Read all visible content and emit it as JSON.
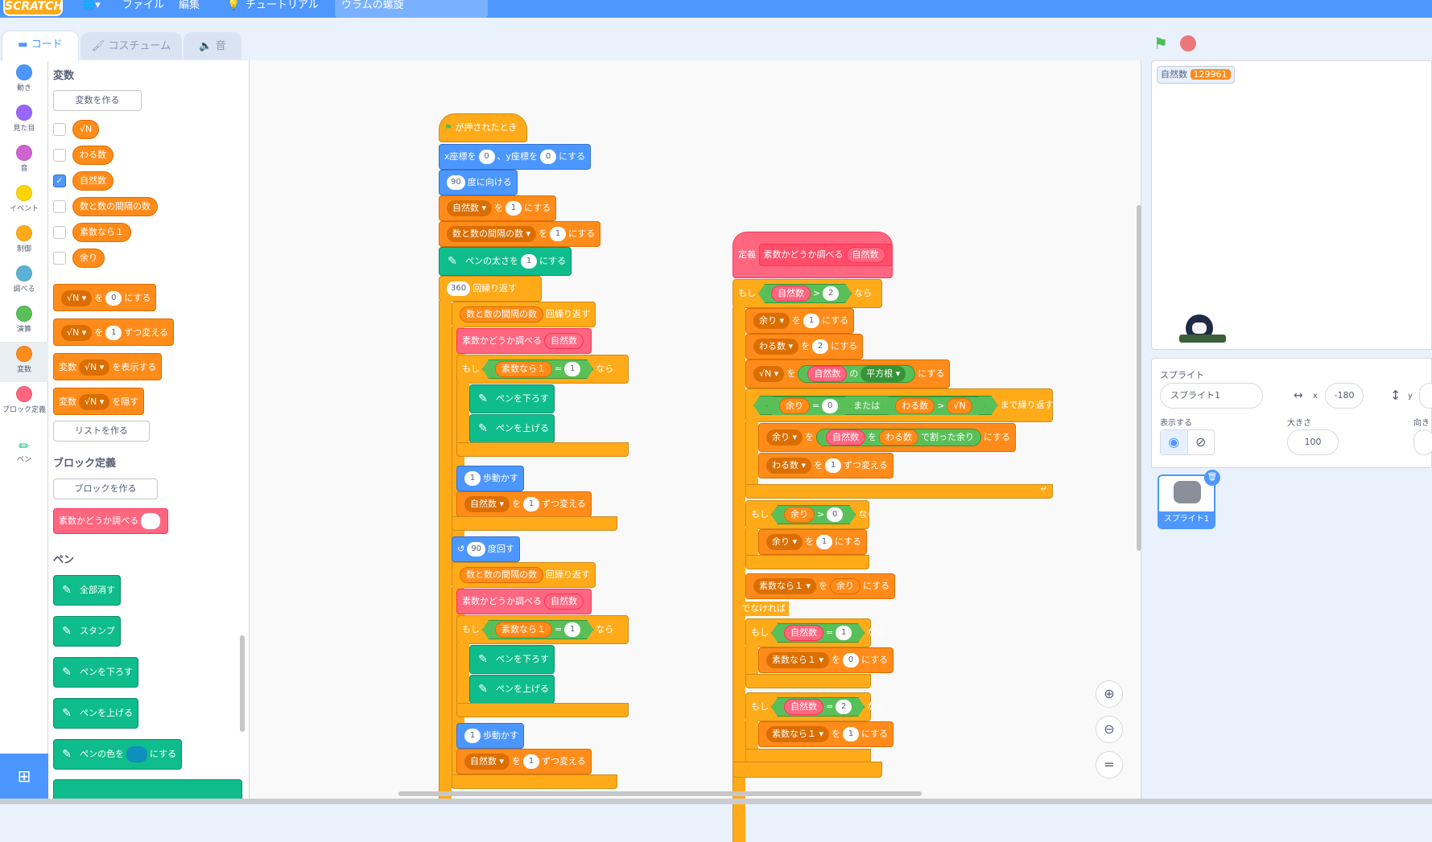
{
  "menubar": {
    "logo": "SCRATCH",
    "globe": "🌐▾",
    "file": "ファイル",
    "edit": "編集",
    "tutorial": "チュートリアル",
    "project_name": "ウラムの螺旋"
  },
  "tabs": {
    "code": "コード",
    "costumes": "コスチューム",
    "sounds": "音"
  },
  "categories": [
    {
      "label": "動き",
      "color": "#4c97ff"
    },
    {
      "label": "見た目",
      "color": "#9966ff"
    },
    {
      "label": "音",
      "color": "#cf63cf"
    },
    {
      "label": "イベント",
      "color": "#ffd500"
    },
    {
      "label": "制御",
      "color": "#ffab19"
    },
    {
      "label": "調べる",
      "color": "#5cb1d6"
    },
    {
      "label": "演算",
      "color": "#59c059"
    },
    {
      "label": "変数",
      "color": "#ff8c1a"
    },
    {
      "label": "ブロック定義",
      "color": "#ff6680"
    },
    {
      "label": "ペン",
      "color": "#0fbd8c"
    }
  ],
  "palette": {
    "variables_heading": "変数",
    "make_variable": "変数を作る",
    "variables": [
      "√N",
      "わる数",
      "自然数",
      "数と数の間隔の数",
      "素数なら１",
      "余り"
    ],
    "checked_variable": "自然数",
    "set_block": {
      "var": "√N ▾",
      "to": "を",
      "value": "0",
      "end": "にする"
    },
    "change_block": {
      "var": "√N ▾",
      "to": "を",
      "value": "1",
      "end": "ずつ変える"
    },
    "show_block": {
      "prefix": "変数",
      "var": "√N ▾",
      "end": "を表示する"
    },
    "hide_block": {
      "prefix": "変数",
      "var": "√N ▾",
      "end": "を隠す"
    },
    "make_list": "リストを作る",
    "myblocks_heading": "ブロック定義",
    "make_block": "ブロックを作る",
    "custom_block": "素数かどうか調べる",
    "pen_heading": "ペン",
    "pen_blocks": [
      "全部消す",
      "スタンプ",
      "ペンを下ろす",
      "ペンを上げる"
    ],
    "pen_color": {
      "prefix": "ペンの色を",
      "end": "にする"
    }
  },
  "script1": {
    "hat": "が押されたとき",
    "goto": {
      "x_label": "x座標を",
      "x": "0",
      "y_label": "、y座標を",
      "y": "0",
      "end": "にする"
    },
    "point": {
      "value": "90",
      "end": "度に向ける"
    },
    "set1": {
      "var": "自然数 ▾",
      "to": "を",
      "value": "1",
      "end": "にする"
    },
    "set2": {
      "var": "数と数の間隔の数 ▾",
      "to": "を",
      "value": "1",
      "end": "にする"
    },
    "pensize": {
      "label": "ペンの太さを",
      "value": "1",
      "end": "にする"
    },
    "repeat": {
      "value": "360",
      "end": "回繰り返す"
    },
    "inner_repeat": {
      "var": "数と数の間隔の数",
      "end": "回繰り返す"
    },
    "call": {
      "label": "素数かどうか調べる",
      "arg": "自然数"
    },
    "if": {
      "label": "もし",
      "var": "素数なら１",
      "op": "=",
      "value": "1",
      "end": "なら"
    },
    "pen_down": "ペンを下ろす",
    "pen_up": "ペンを上げる",
    "move": {
      "value": "1",
      "end": "歩動かす"
    },
    "change": {
      "var": "自然数 ▾",
      "to": "を",
      "value": "1",
      "end": "ずつ変える"
    },
    "turn": {
      "value": "90",
      "end": "度回す"
    }
  },
  "script2": {
    "define_label": "定義",
    "define_name": "素数かどうか調べる",
    "define_arg": "自然数",
    "if1": {
      "label": "もし",
      "var": "自然数",
      "op": ">",
      "value": "2",
      "end": "なら"
    },
    "set_rem": {
      "var": "余り ▾",
      "to": "を",
      "value": "1",
      "end": "にする"
    },
    "set_div": {
      "var": "わる数 ▾",
      "to": "を",
      "value": "2",
      "end": "にする"
    },
    "set_sqrt": {
      "var": "√N ▾",
      "to": "を",
      "arg": "自然数",
      "of": "の",
      "func": "平方根 ▾",
      "end": "にする"
    },
    "until": {
      "var1": "余り",
      "eq": "=",
      "v1": "0",
      "or": "または",
      "var2": "わる数",
      "gt": ">",
      "var3": "√N",
      "end": "まで繰り返す"
    },
    "set_mod": {
      "var": "余り ▾",
      "to": "を",
      "a": "自然数",
      "mid": "を",
      "b": "わる数",
      "op": "で割った余り",
      "end": "にする"
    },
    "change_div": {
      "var": "わる数 ▾",
      "to": "を",
      "value": "1",
      "end": "ずつ変える"
    },
    "if2": {
      "label": "もし",
      "var": "余り",
      "op": ">",
      "value": "0",
      "end": "なら"
    },
    "set_rem2": {
      "var": "余り ▾",
      "to": "を",
      "value": "1",
      "end": "にする"
    },
    "set_prime": {
      "var": "素数なら１ ▾",
      "to": "を",
      "arg": "余り",
      "end": "にする"
    },
    "else": "でなければ",
    "if3": {
      "label": "もし",
      "var": "自然数",
      "op": "=",
      "value": "1",
      "end": "なら"
    },
    "set_prime0": {
      "var": "素数なら１ ▾",
      "to": "を",
      "value": "0",
      "end": "にする"
    },
    "if4": {
      "label": "もし",
      "var": "自然数",
      "op": "=",
      "value": "2",
      "end": "なら"
    },
    "set_prime1": {
      "var": "素数なら１ ▾",
      "to": "を",
      "value": "1",
      "end": "にする"
    }
  },
  "stage": {
    "monitor_label": "自然数",
    "monitor_value": "129961"
  },
  "sprite_info": {
    "heading": "スプライト",
    "name": "スプライト1",
    "x_label": "x",
    "x": "-180",
    "y_label": "y",
    "show_label": "表示する",
    "size_label": "大きさ",
    "size": "100",
    "direction_label": "向き"
  },
  "sprite_list": {
    "thumb_label": "スプライト1"
  },
  "colors": {
    "menubar": "#4d97ff",
    "variables": "#ff8c1a",
    "control": "#ffab19",
    "myblocks": "#ff6680",
    "pen": "#0fbd8c",
    "operators": "#59c059",
    "motion": "#4c97ff"
  }
}
